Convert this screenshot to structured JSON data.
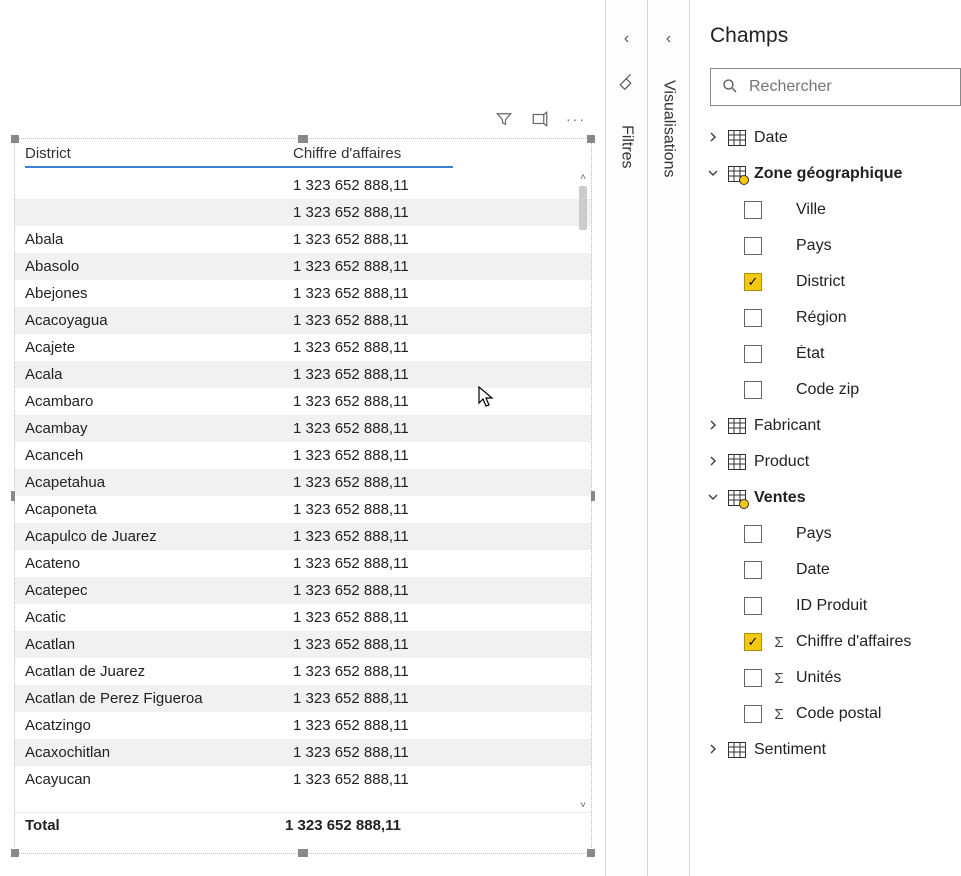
{
  "table": {
    "columns": {
      "c1": "District",
      "c2": "Chiffre d'affaires"
    },
    "total_label": "Total",
    "total_value": "1 323 652 888,11",
    "value": "1 323 652 888,11",
    "rows": [
      "",
      "",
      "Abala",
      "Abasolo",
      "Abejones",
      "Acacoyagua",
      "Acajete",
      "Acala",
      "Acambaro",
      "Acambay",
      "Acanceh",
      "Acapetahua",
      "Acaponeta",
      "Acapulco de Juarez",
      "Acateno",
      "Acatepec",
      "Acatic",
      "Acatlan",
      "Acatlan de Juarez",
      "Acatlan de Perez Figueroa",
      "Acatzingo",
      "Acaxochitlan",
      "Acayucan"
    ]
  },
  "rails": {
    "filters_label": "Filtres",
    "viz_label": "Visualisations"
  },
  "fields": {
    "title": "Champs",
    "search_placeholder": "Rechercher",
    "tables": [
      {
        "name": "Date",
        "expanded": false,
        "badge": false,
        "fields": []
      },
      {
        "name": "Zone géographique",
        "expanded": true,
        "badge": true,
        "fields": [
          {
            "label": "Ville",
            "checked": false,
            "sigma": false
          },
          {
            "label": "Pays",
            "checked": false,
            "sigma": false
          },
          {
            "label": "District",
            "checked": true,
            "sigma": false
          },
          {
            "label": "Région",
            "checked": false,
            "sigma": false
          },
          {
            "label": "État",
            "checked": false,
            "sigma": false
          },
          {
            "label": "Code zip",
            "checked": false,
            "sigma": false
          }
        ]
      },
      {
        "name": "Fabricant",
        "expanded": false,
        "badge": false,
        "fields": []
      },
      {
        "name": "Product",
        "expanded": false,
        "badge": false,
        "fields": []
      },
      {
        "name": "Ventes",
        "expanded": true,
        "badge": true,
        "fields": [
          {
            "label": "Pays",
            "checked": false,
            "sigma": false
          },
          {
            "label": "Date",
            "checked": false,
            "sigma": false
          },
          {
            "label": "ID Produit",
            "checked": false,
            "sigma": false
          },
          {
            "label": "Chiffre d'affaires",
            "checked": true,
            "sigma": true
          },
          {
            "label": "Unités",
            "checked": false,
            "sigma": true
          },
          {
            "label": "Code postal",
            "checked": false,
            "sigma": true
          }
        ]
      },
      {
        "name": "Sentiment",
        "expanded": false,
        "badge": false,
        "fields": []
      }
    ]
  },
  "toolbar": {
    "filter_tip": "Filter",
    "focus_tip": "Focus",
    "more_tip": "More"
  }
}
